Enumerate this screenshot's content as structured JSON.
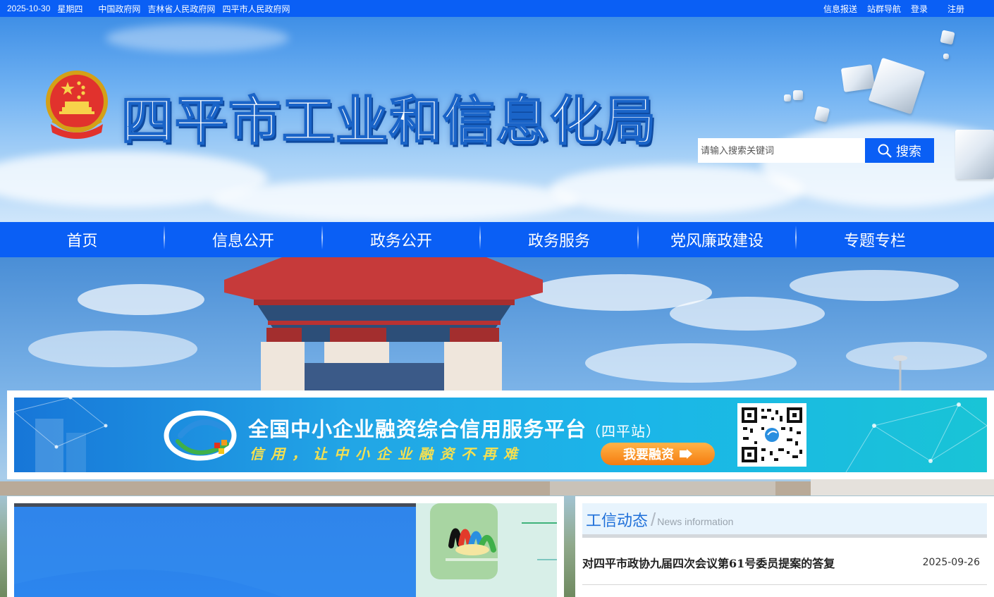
{
  "topbar": {
    "date": "2025-10-30",
    "weekday": "星期四",
    "links": [
      "中国政府网",
      "吉林省人民政府网",
      "四平市人民政府网"
    ],
    "right_links": [
      "信息报送",
      "站群导航",
      "登录",
      "注册"
    ]
  },
  "header": {
    "site_title": "四平市工业和信息化局",
    "search": {
      "placeholder": "请输入搜索关键词",
      "button_label": "搜索"
    }
  },
  "nav": {
    "items": [
      "首页",
      "信息公开",
      "政务公开",
      "政务服务",
      "党风廉政建设",
      "专题专栏"
    ]
  },
  "banner": {
    "title": "全国中小企业融资综合信用服务平台",
    "title_suffix": "（四平站）",
    "subtitle": "信用，让中小企业融资不再难",
    "button_label": "我要融资"
  },
  "news": {
    "title": "工信动态",
    "subtitle": "News information",
    "items": [
      {
        "title": "对四平市政协九届四次会议第61号委员提案的答复",
        "date": "2025-09-26"
      }
    ]
  },
  "colors": {
    "primary": "#0a5ff5",
    "banner_button": "#f57c10"
  }
}
